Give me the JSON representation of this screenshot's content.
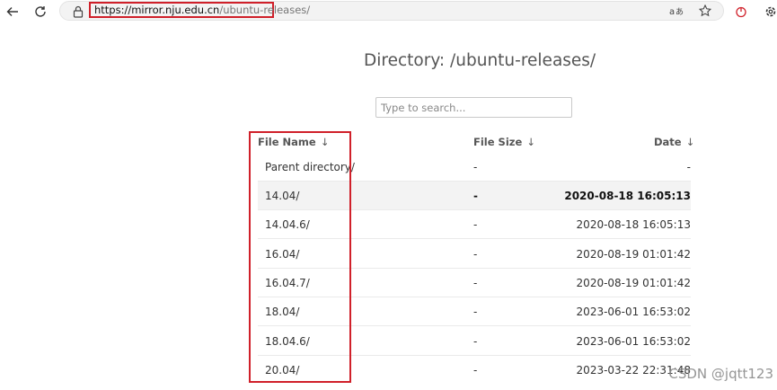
{
  "browser": {
    "url_host": "https://mirror.nju.edu.cn",
    "url_path": "/ubuntu-releases/",
    "icons": [
      "back-icon",
      "reload-icon",
      "lock-icon",
      "read-aloud-icon",
      "favorite-star-icon",
      "extension-icon",
      "settings-icon"
    ]
  },
  "page": {
    "title": "Directory: /ubuntu-releases/",
    "search_placeholder": "Type to search..."
  },
  "table": {
    "columns": [
      {
        "label": "File Name",
        "sort": "↓"
      },
      {
        "label": "File Size",
        "sort": "↓"
      },
      {
        "label": "Date",
        "sort": "↓"
      }
    ],
    "rows": [
      {
        "name": "Parent directory/",
        "size": "-",
        "date": "-"
      },
      {
        "name": "14.04/",
        "size": "-",
        "date": "2020-08-18 16:05:13"
      },
      {
        "name": "14.04.6/",
        "size": "-",
        "date": "2020-08-18 16:05:13"
      },
      {
        "name": "16.04/",
        "size": "-",
        "date": "2020-08-19 01:01:42"
      },
      {
        "name": "16.04.7/",
        "size": "-",
        "date": "2020-08-19 01:01:42"
      },
      {
        "name": "18.04/",
        "size": "-",
        "date": "2023-06-01 16:53:02"
      },
      {
        "name": "18.04.6/",
        "size": "-",
        "date": "2023-06-01 16:53:02"
      },
      {
        "name": "20.04/",
        "size": "-",
        "date": "2023-03-22 22:31:48"
      }
    ]
  },
  "watermark": "CSDN @jqtt123",
  "colors": {
    "annotation_red": "#d0202a",
    "row_highlight": "#f3f3f3"
  }
}
